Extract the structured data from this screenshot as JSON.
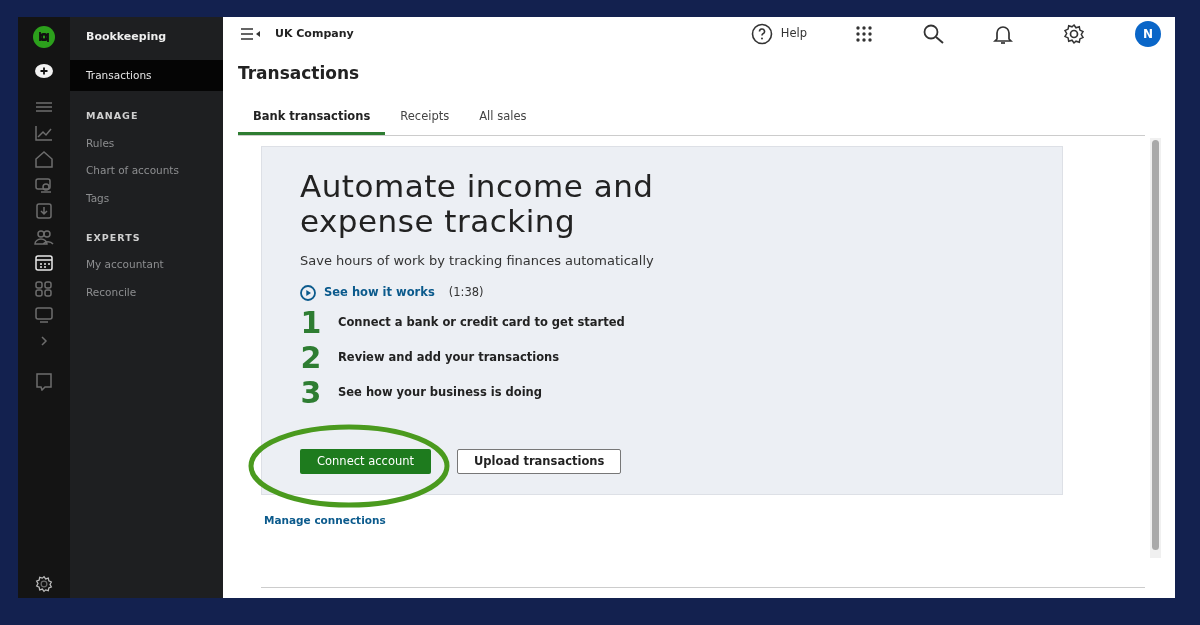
{
  "rail": [
    {
      "selected": false
    },
    {
      "selected": false
    },
    {
      "selected": false
    },
    {
      "selected": false
    },
    {
      "selected": false
    },
    {
      "selected": false
    },
    {
      "selected": true
    },
    {
      "selected": false
    },
    {
      "selected": false
    },
    {
      "selected": false
    }
  ],
  "sidebar": {
    "title": "Bookkeeping",
    "items": [
      {
        "label": "Transactions",
        "kind": "item",
        "selected": true
      },
      {
        "label": "MANAGE",
        "kind": "section"
      },
      {
        "label": "Rules",
        "kind": "item",
        "selected": false
      },
      {
        "label": "Chart of accounts",
        "kind": "item",
        "selected": false
      },
      {
        "label": "Tags",
        "kind": "item",
        "selected": false
      },
      {
        "label": "EXPERTS",
        "kind": "section"
      },
      {
        "label": "My accountant",
        "kind": "item",
        "selected": false
      },
      {
        "label": "Reconcile",
        "kind": "item",
        "selected": false
      }
    ]
  },
  "header": {
    "company": "UK Company",
    "help": "Help",
    "avatar": "N"
  },
  "page_title": "Transactions",
  "tabs": [
    {
      "label": "Bank transactions",
      "selected": true
    },
    {
      "label": "Receipts",
      "selected": false
    },
    {
      "label": "All sales",
      "selected": false
    }
  ],
  "promo": {
    "heading": "Automate income and expense tracking",
    "subtitle": "Save hours of work by tracking finances automatically",
    "video_link": "See how it works",
    "video_length": "(1:38)",
    "steps": [
      {
        "number": "1",
        "text": "Connect a bank or credit card to get started"
      },
      {
        "number": "2",
        "text": "Review and add your transactions"
      },
      {
        "number": "3",
        "text": "See how your business is doing"
      }
    ],
    "primary_button": "Connect account",
    "secondary_button": "Upload transactions",
    "highlight_primary": true
  },
  "manage_link": "Manage connections"
}
